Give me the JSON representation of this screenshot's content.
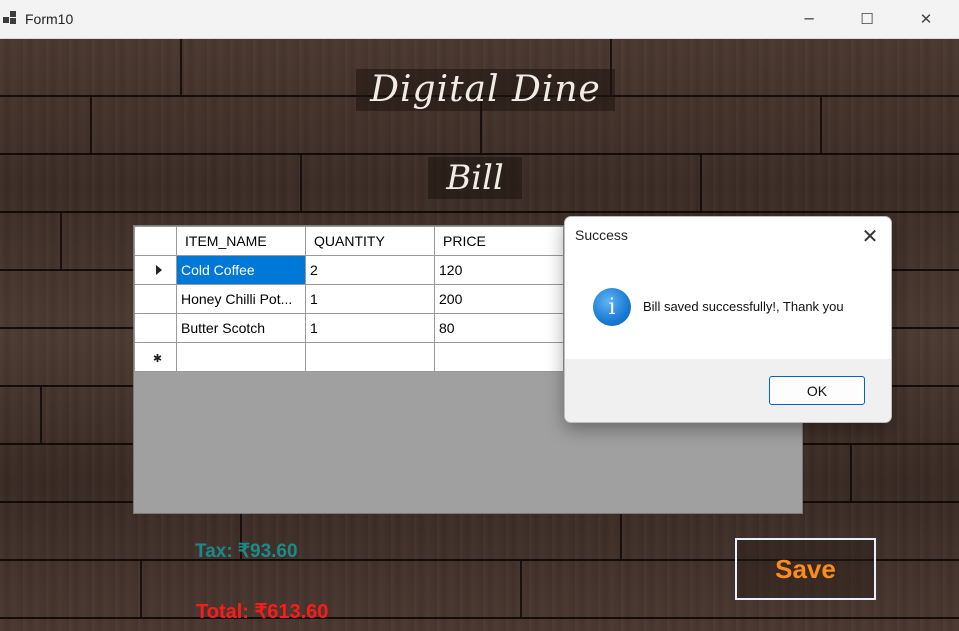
{
  "window": {
    "title": "Form10",
    "minimize_glyph": "─",
    "maximize_glyph": "☐",
    "close_glyph": "✕",
    "icon": "app-window-icon"
  },
  "header": {
    "brand": "Digital Dine",
    "subtitle": "Bill"
  },
  "grid": {
    "columns": [
      "ITEM_NAME",
      "QUANTITY",
      "PRICE"
    ],
    "rows": [
      {
        "item_name": "Cold Coffee",
        "quantity": "2",
        "price": "120",
        "selected": true
      },
      {
        "item_name": "Honey Chilli Pot...",
        "quantity": "1",
        "price": "200",
        "selected": false
      },
      {
        "item_name": "Butter Scotch",
        "quantity": "1",
        "price": "80",
        "selected": false
      }
    ]
  },
  "summary": {
    "tax": "Tax: ₹93.60",
    "total": "Total: ₹613.60"
  },
  "actions": {
    "save_label": "Save"
  },
  "dialog": {
    "title": "Success",
    "message": "Bill saved successfully!, Thank you",
    "icon": "info-icon",
    "icon_glyph": "i",
    "close_glyph": "✕",
    "ok_label": "OK"
  },
  "colors": {
    "selection": "#0078d7",
    "tax_text": "#1a8a8a",
    "total_text": "#ff1a1a",
    "save_text": "#ff8c1a"
  }
}
